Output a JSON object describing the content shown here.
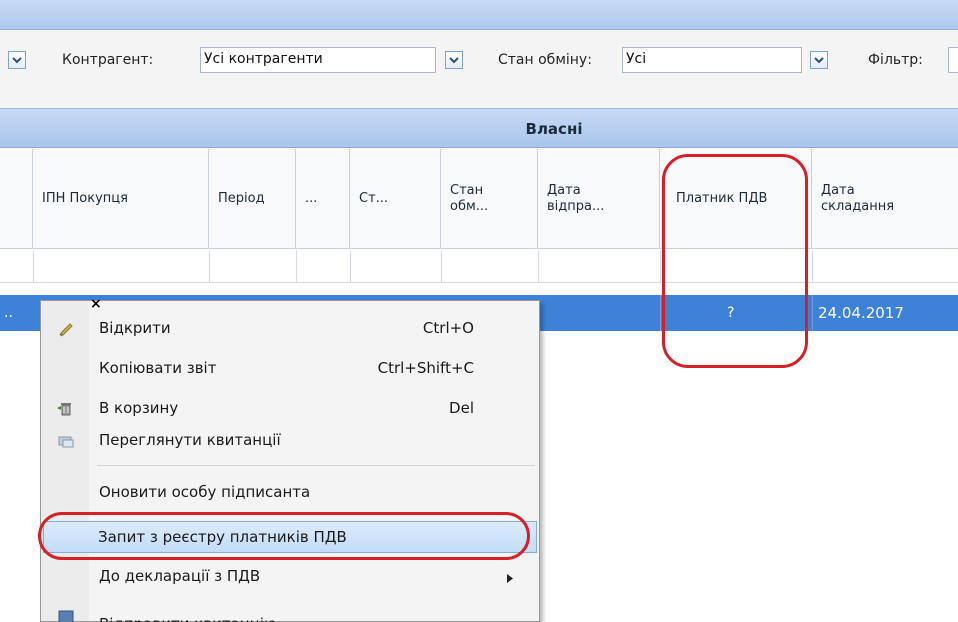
{
  "filters": {
    "counterparty_label": "Контрагент:",
    "counterparty_value": "Усі контрагенти",
    "exchange_state_label": "Стан обміну:",
    "exchange_state_value": "Усі",
    "filter_label": "Фільтр:",
    "filter_value": ""
  },
  "group_header": "Власні",
  "columns": [
    {
      "label": "ІПН Покупця"
    },
    {
      "label": "Період"
    },
    {
      "label": "..."
    },
    {
      "label": "Ст..."
    },
    {
      "label": "Стан обм..."
    },
    {
      "label": "Дата відпра..."
    },
    {
      "label": "Платник ПДВ"
    },
    {
      "label": "Дата складання"
    }
  ],
  "row": {
    "lead": "..",
    "vat_payer": "?",
    "date": "24.04.2017"
  },
  "context_menu": {
    "close_glyph": "×",
    "items": [
      {
        "label": "Відкрити",
        "shortcut": "Ctrl+O",
        "icon": "open-icon"
      },
      {
        "label": "Копіювати звіт",
        "shortcut": "Ctrl+Shift+C",
        "icon": ""
      },
      {
        "label": "В корзину",
        "shortcut": "Del",
        "icon": "trash-icon"
      },
      {
        "label": "Переглянути квитанції",
        "shortcut": "",
        "icon": "receipts-icon"
      },
      {
        "label": "Оновити особу підписанта",
        "shortcut": "",
        "icon": ""
      },
      {
        "label": "Запит з реєстру платників ПДВ",
        "shortcut": "",
        "icon": ""
      },
      {
        "label": "До декларації з ПДВ",
        "shortcut": "",
        "icon": "",
        "submenu": true
      },
      {
        "label": "Відправити квитанцію",
        "shortcut": "",
        "icon": "send-icon"
      }
    ]
  },
  "colors": {
    "header_blue": "#a9c5ec",
    "selection_blue": "#3d82d8",
    "highlight_red": "#d61f26"
  }
}
